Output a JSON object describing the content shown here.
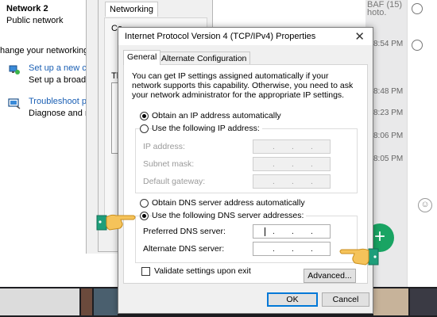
{
  "background": {
    "network": {
      "name": "Network  2",
      "type": "Public network"
    },
    "change_heading": "hange your networking set",
    "tasks": [
      {
        "link": "Set up a new conr",
        "desc": "Set up a broadban"
      },
      {
        "link": "Troubleshoot prob",
        "desc": "Diagnose and rep"
      }
    ],
    "adapter_props": {
      "tab": "Networking",
      "connect_label": "Co",
      "this_label": "Th"
    },
    "chat": {
      "top_text": "BAF (15)",
      "sub_text": "hoto.",
      "times": [
        "8:54 PM",
        "8:48 PM",
        "8:23 PM",
        "8:06 PM",
        "8:05 PM"
      ],
      "fab_label": "+",
      "emoji": "☺"
    }
  },
  "dialog": {
    "title": "Internet Protocol Version 4 (TCP/IPv4) Properties",
    "close_label": "✕",
    "tabs": [
      "General",
      "Alternate Configuration"
    ],
    "intro": "You can get IP settings assigned automatically if your network supports this capability. Otherwise, you need to ask your network administrator for the appropriate IP settings.",
    "ip_auto_label": "Obtain an IP address automatically",
    "ip_manual_label": "Use the following IP address:",
    "ip_fields": [
      {
        "label": "IP address:",
        "value": ". . ."
      },
      {
        "label": "Subnet mask:",
        "value": ". . ."
      },
      {
        "label": "Default gateway:",
        "value": ". . ."
      }
    ],
    "dns_auto_label": "Obtain DNS server address automatically",
    "dns_manual_label": "Use the following DNS server addresses:",
    "dns_fields": [
      {
        "label": "Preferred DNS server:",
        "value": ". . ."
      },
      {
        "label": "Alternate DNS server:",
        "value": ". . ."
      }
    ],
    "validate_label": "Validate settings upon exit",
    "advanced_label": "Advanced...",
    "ok_label": "OK",
    "cancel_label": "Cancel",
    "selected_ip_option": "auto",
    "selected_dns_option": "manual"
  },
  "colors": {
    "accent": "#0078d7",
    "link": "#1a5fb4",
    "fab": "#19a463",
    "hand_skin": "#f5c35a",
    "hand_cuff": "#1f9e7a"
  }
}
